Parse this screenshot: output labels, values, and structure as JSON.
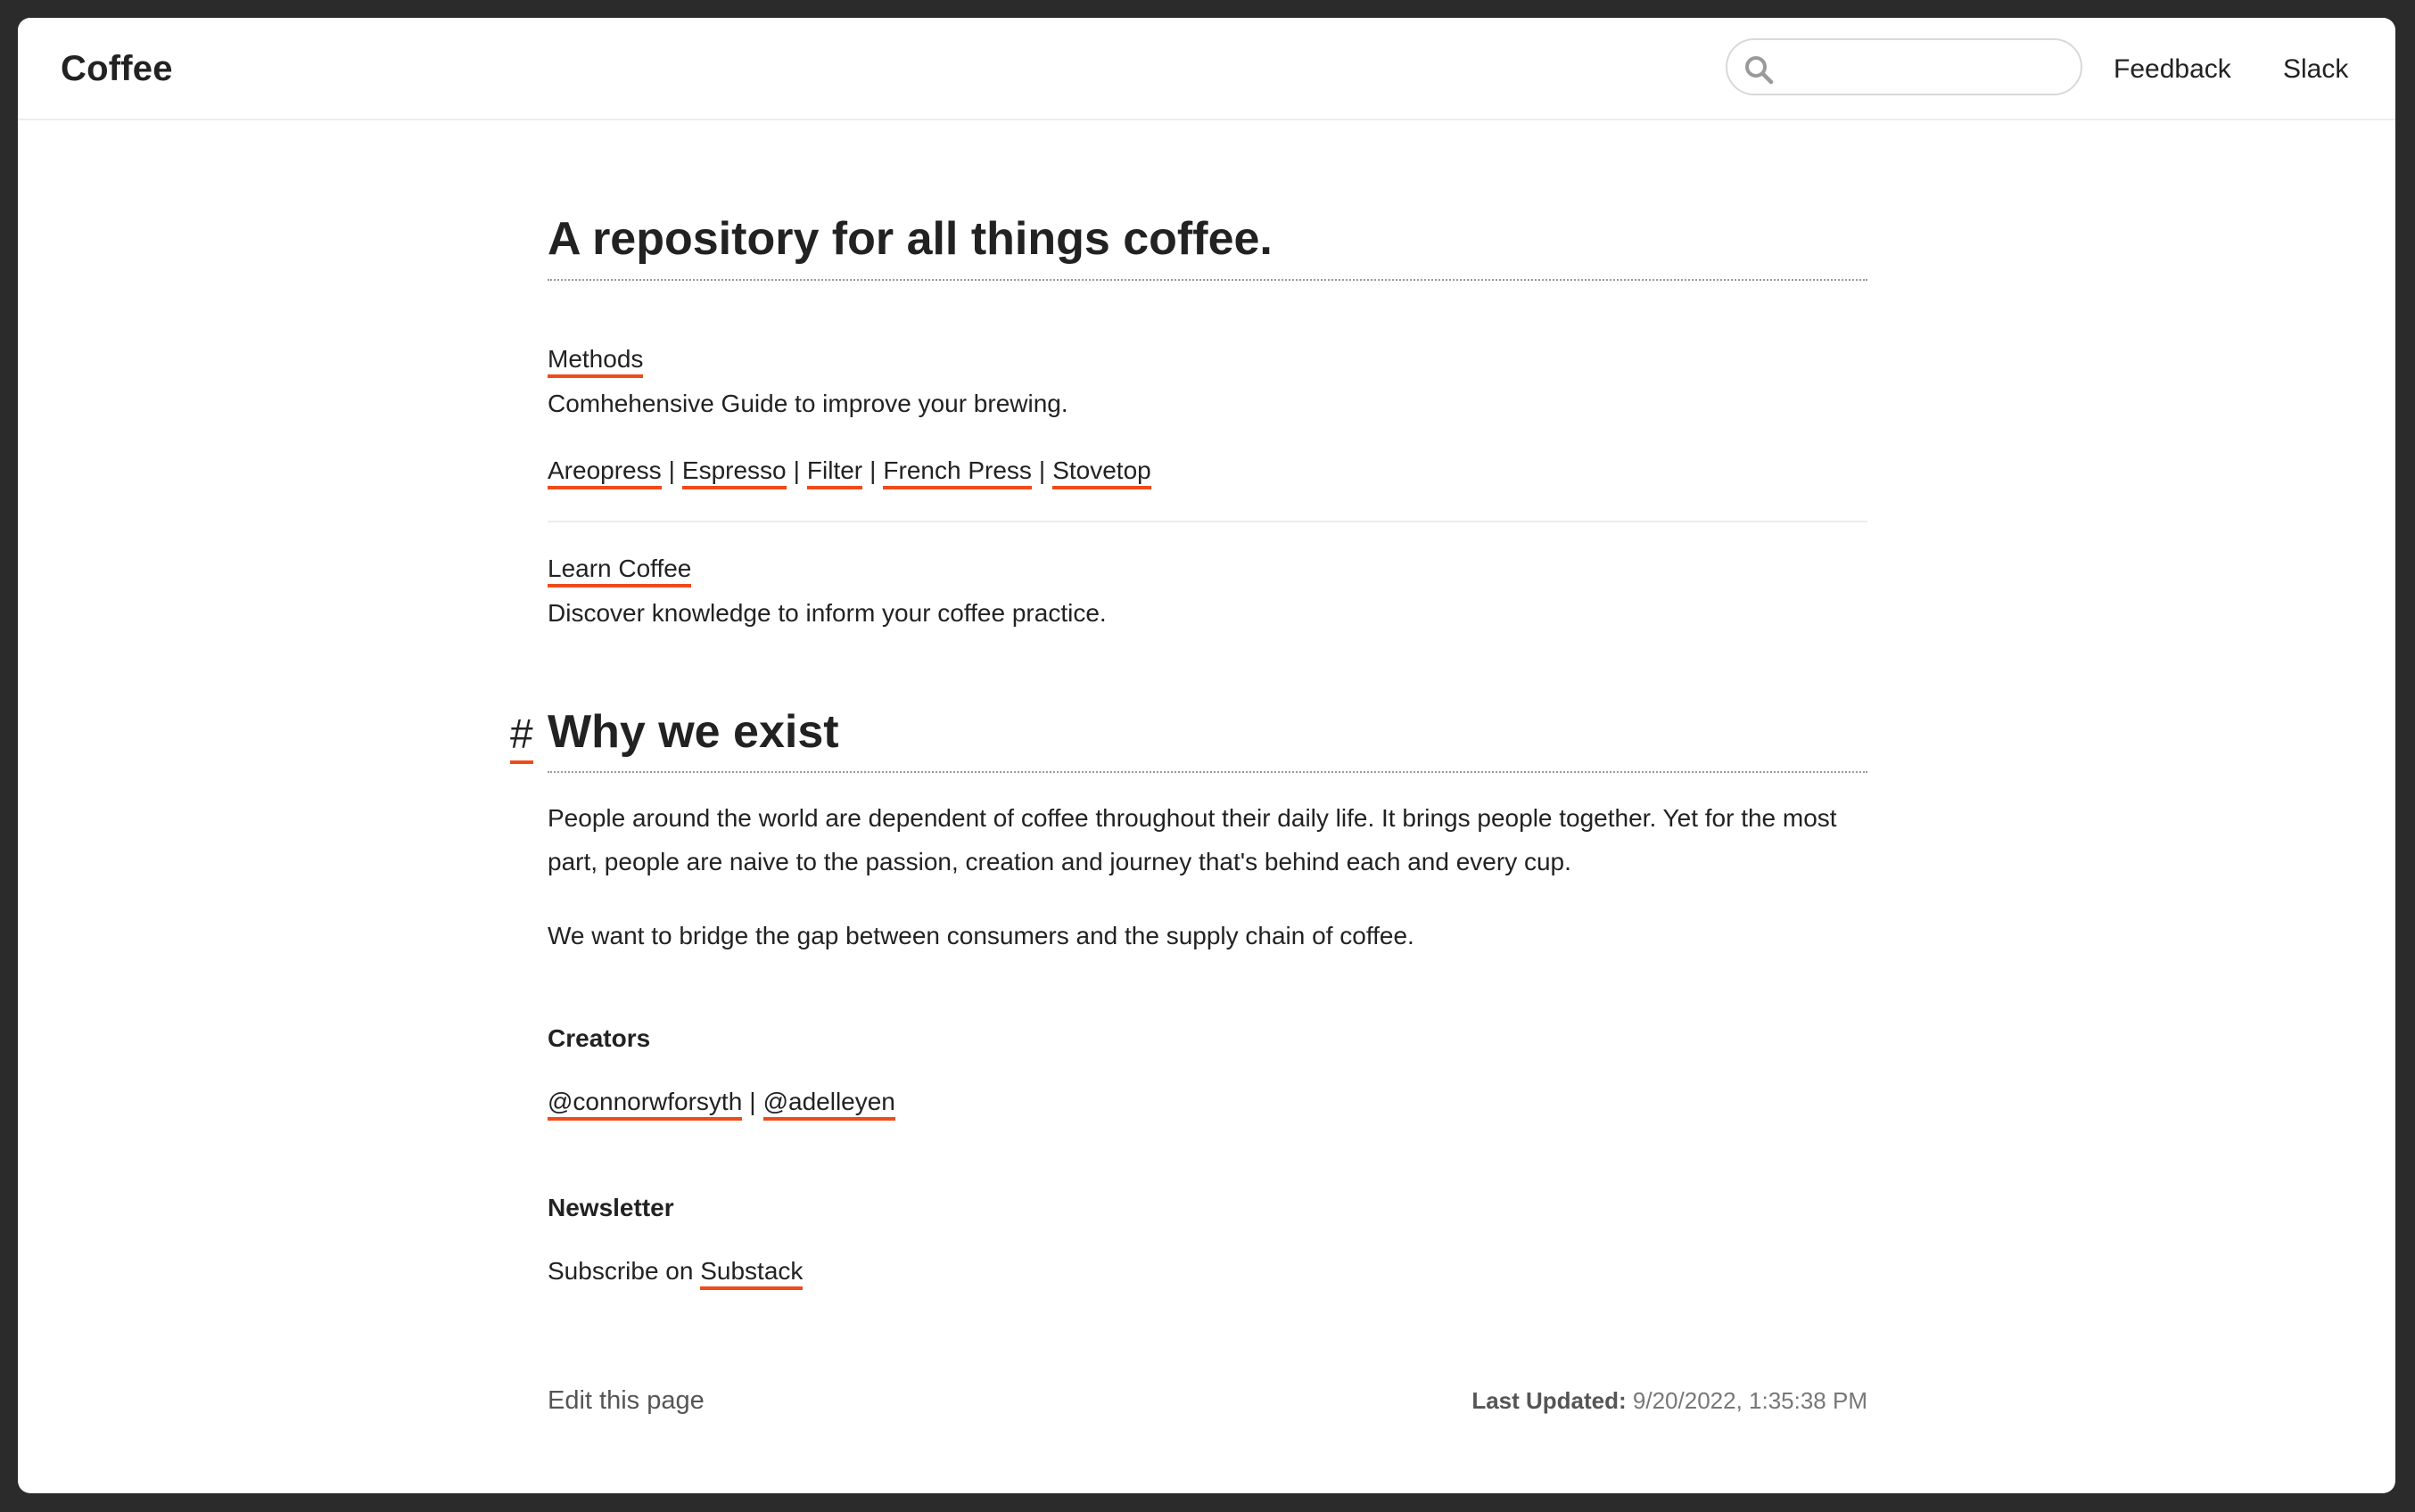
{
  "header": {
    "brand": "Coffee",
    "search": {
      "value": "",
      "placeholder": ""
    },
    "nav": {
      "feedback": "Feedback",
      "slack": "Slack"
    }
  },
  "hero": {
    "title": "A repository for all things coffee."
  },
  "methods": {
    "link": "Methods",
    "description": "Comhehensive Guide to improve your brewing.",
    "items": [
      "Areopress",
      "Espresso",
      "Filter",
      "French Press",
      "Stovetop"
    ],
    "separator": "|"
  },
  "learn": {
    "link": "Learn Coffee",
    "description": "Discover knowledge to inform your coffee practice."
  },
  "why": {
    "anchor": "#",
    "title": "Why we exist",
    "paragraph1": "People around the world are dependent of coffee throughout their daily life. It brings people together. Yet for the most part, people are naive to the passion, creation and journey that's behind each and every cup.",
    "paragraph2": "We want to bridge the gap between consumers and the supply chain of coffee."
  },
  "creators": {
    "title": "Creators",
    "handles": [
      "@connorwforsyth",
      "@adelleyen"
    ],
    "separator": "|"
  },
  "newsletter": {
    "title": "Newsletter",
    "prefix": "Subscribe on",
    "link": "Substack"
  },
  "footer": {
    "edit": "Edit this page",
    "updated_label": "Last Updated:",
    "updated_value": "9/20/2022, 1:35:38 PM"
  },
  "colors": {
    "accent_underline": "#f04a1b",
    "text": "#222222",
    "frame": "#2b2b2b"
  },
  "icons": {
    "search": "search-icon"
  }
}
